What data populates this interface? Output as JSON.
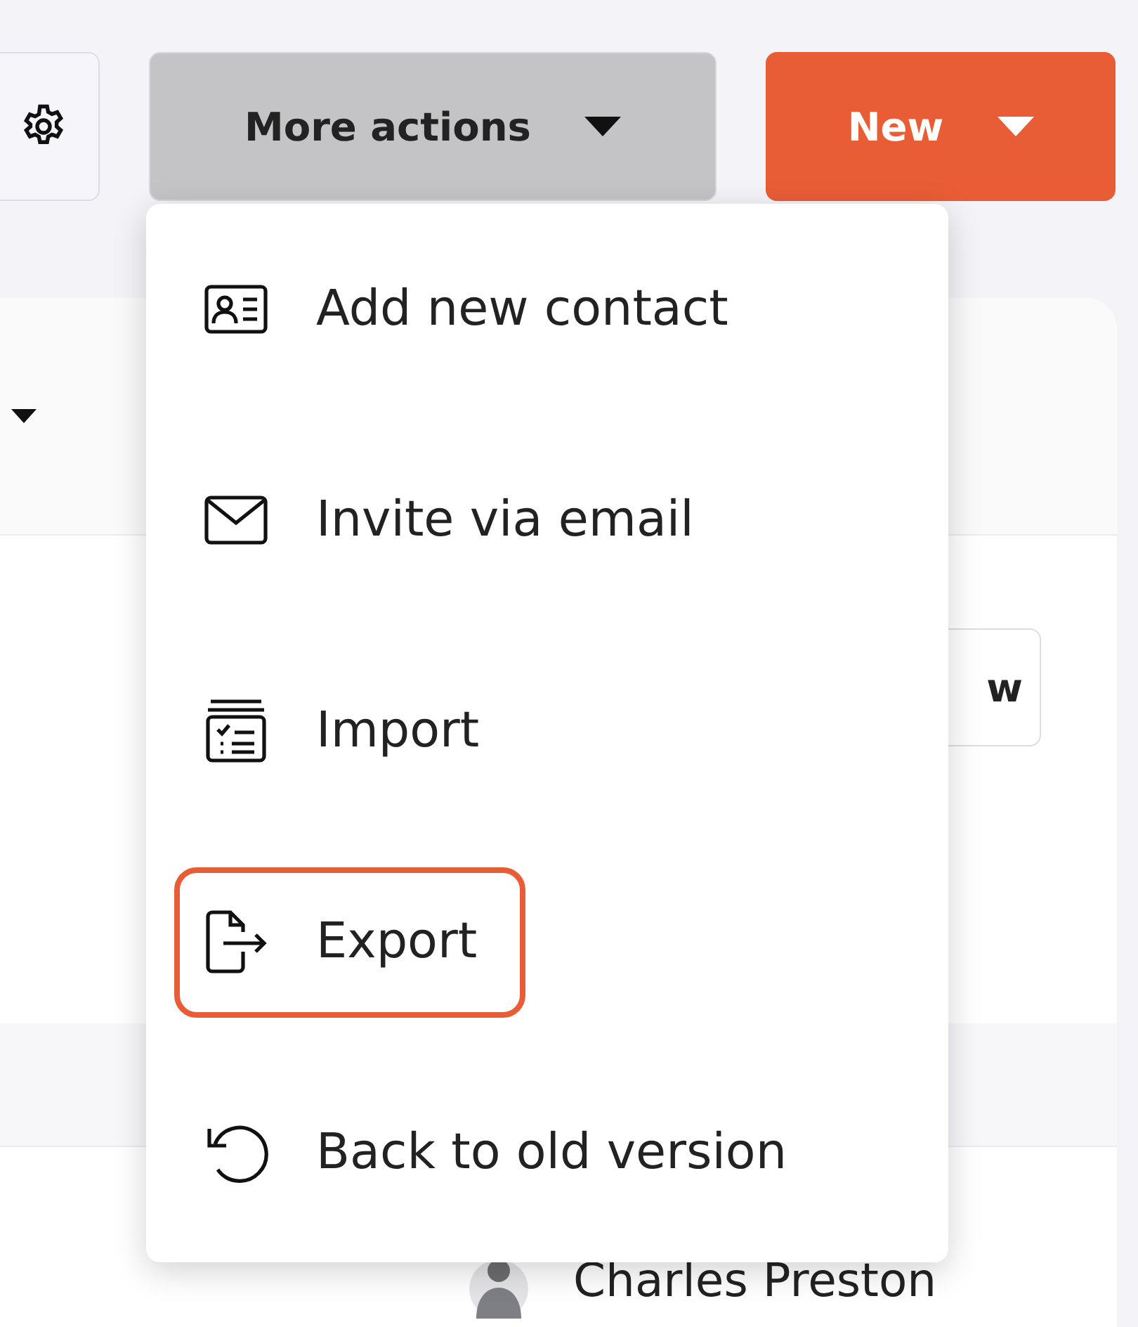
{
  "toolbar": {
    "more_actions": {
      "label": "More actions",
      "expanded": true
    },
    "new_button": {
      "label": "New"
    }
  },
  "menu": {
    "items": [
      {
        "label": "Add new contact",
        "kind": "contact",
        "selected": false
      },
      {
        "label": "Invite via email",
        "kind": "email",
        "selected": false
      },
      {
        "label": "Import",
        "kind": "import",
        "selected": false
      },
      {
        "label": "Export",
        "kind": "export",
        "selected": true
      },
      {
        "label": "Back to old version",
        "kind": "revert",
        "selected": false
      }
    ]
  },
  "background": {
    "button_label": "w",
    "contact_name": "Charles Preston"
  }
}
